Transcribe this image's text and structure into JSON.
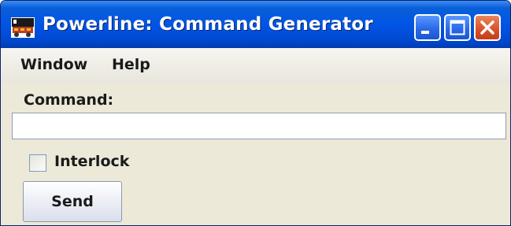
{
  "window": {
    "title": "Powerline: Command Generator",
    "app_icon": "train-locomotive-icon",
    "controls": [
      "minimize-icon",
      "maximize-icon",
      "close-icon"
    ]
  },
  "menubar": {
    "items": [
      {
        "label": "Window"
      },
      {
        "label": "Help"
      }
    ]
  },
  "form": {
    "command_label": "Command:",
    "command_value": "",
    "interlock_label": "Interlock",
    "interlock_checked": false,
    "send_label": "Send"
  },
  "colors": {
    "titlebar": "#0055e5",
    "window_bg": "#ece9d8",
    "close_button": "#d9532c"
  }
}
